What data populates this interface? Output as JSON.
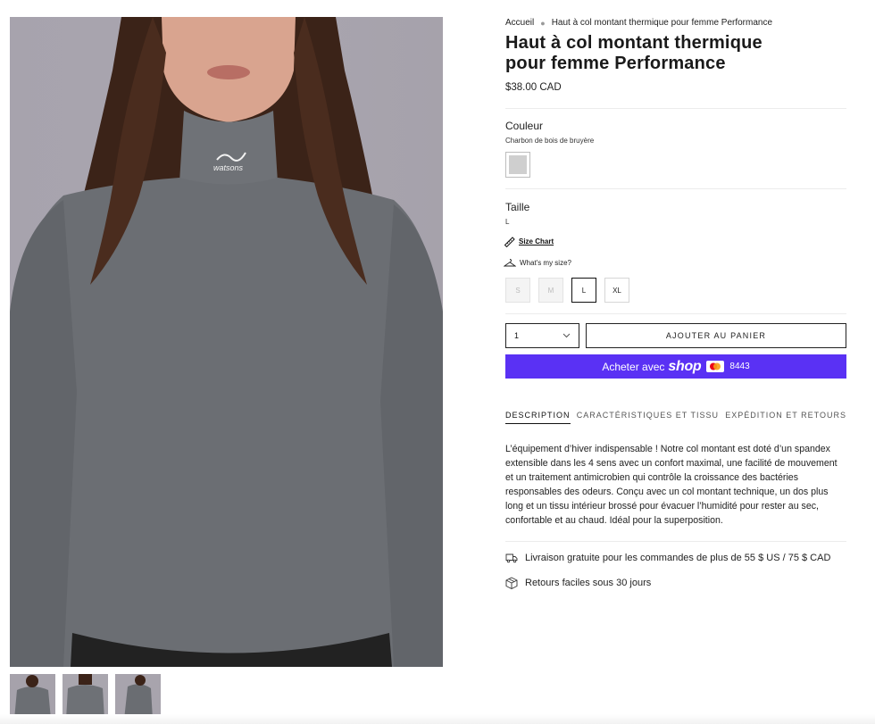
{
  "breadcrumb": {
    "home": "Accueil",
    "current": "Haut à col montant thermique pour femme Performance"
  },
  "product": {
    "title": "Haut à col montant thermique pour femme Performance",
    "price": "$38.00 CAD",
    "garment_logo": "watsons"
  },
  "color": {
    "heading": "Couleur",
    "selected": "Charbon de bois de bruyère",
    "swatch_hex": "#cfcfcf"
  },
  "size": {
    "heading": "Taille",
    "selected": "L",
    "size_chart_label": "Size Chart",
    "fit_label": "What's my size?",
    "options": [
      "S",
      "M",
      "L",
      "XL"
    ]
  },
  "purchase": {
    "quantity": "1",
    "add_to_cart": "AJOUTER AU PANIER",
    "shop_pay_prefix": "Acheter avec",
    "shop_pay_brand": "shop",
    "shop_pay_card_digits": "8443",
    "shop_pay_color": "#5a31f4"
  },
  "tabs": [
    "DESCRIPTION",
    "CARACTÉRISTIQUES ET TISSU",
    "EXPÉDITION ET RETOURS"
  ],
  "description": "L’équipement d’hiver indispensable ! Notre col montant est doté d’un spandex extensible dans les 4 sens avec un confort maximal, une facilité de mouvement et un traitement antimicrobien qui contrôle la croissance des bactéries responsables des odeurs. Conçu avec un col montant technique, un dos plus long et un tissu intérieur brossé pour évacuer l’humidité pour rester au sec, confortable et au chaud. Idéal pour la superposition.",
  "perks": {
    "shipping": "Livraison gratuite pour les commandes de plus de 55 $ US / 75 $ CAD",
    "returns": "Retours faciles sous 30 jours"
  },
  "icons": {
    "shipping": "truck-icon",
    "returns": "box-icon",
    "size_chart": "ruler-icon",
    "fit": "hanger-icon",
    "quantity": "chevron-down-icon"
  }
}
